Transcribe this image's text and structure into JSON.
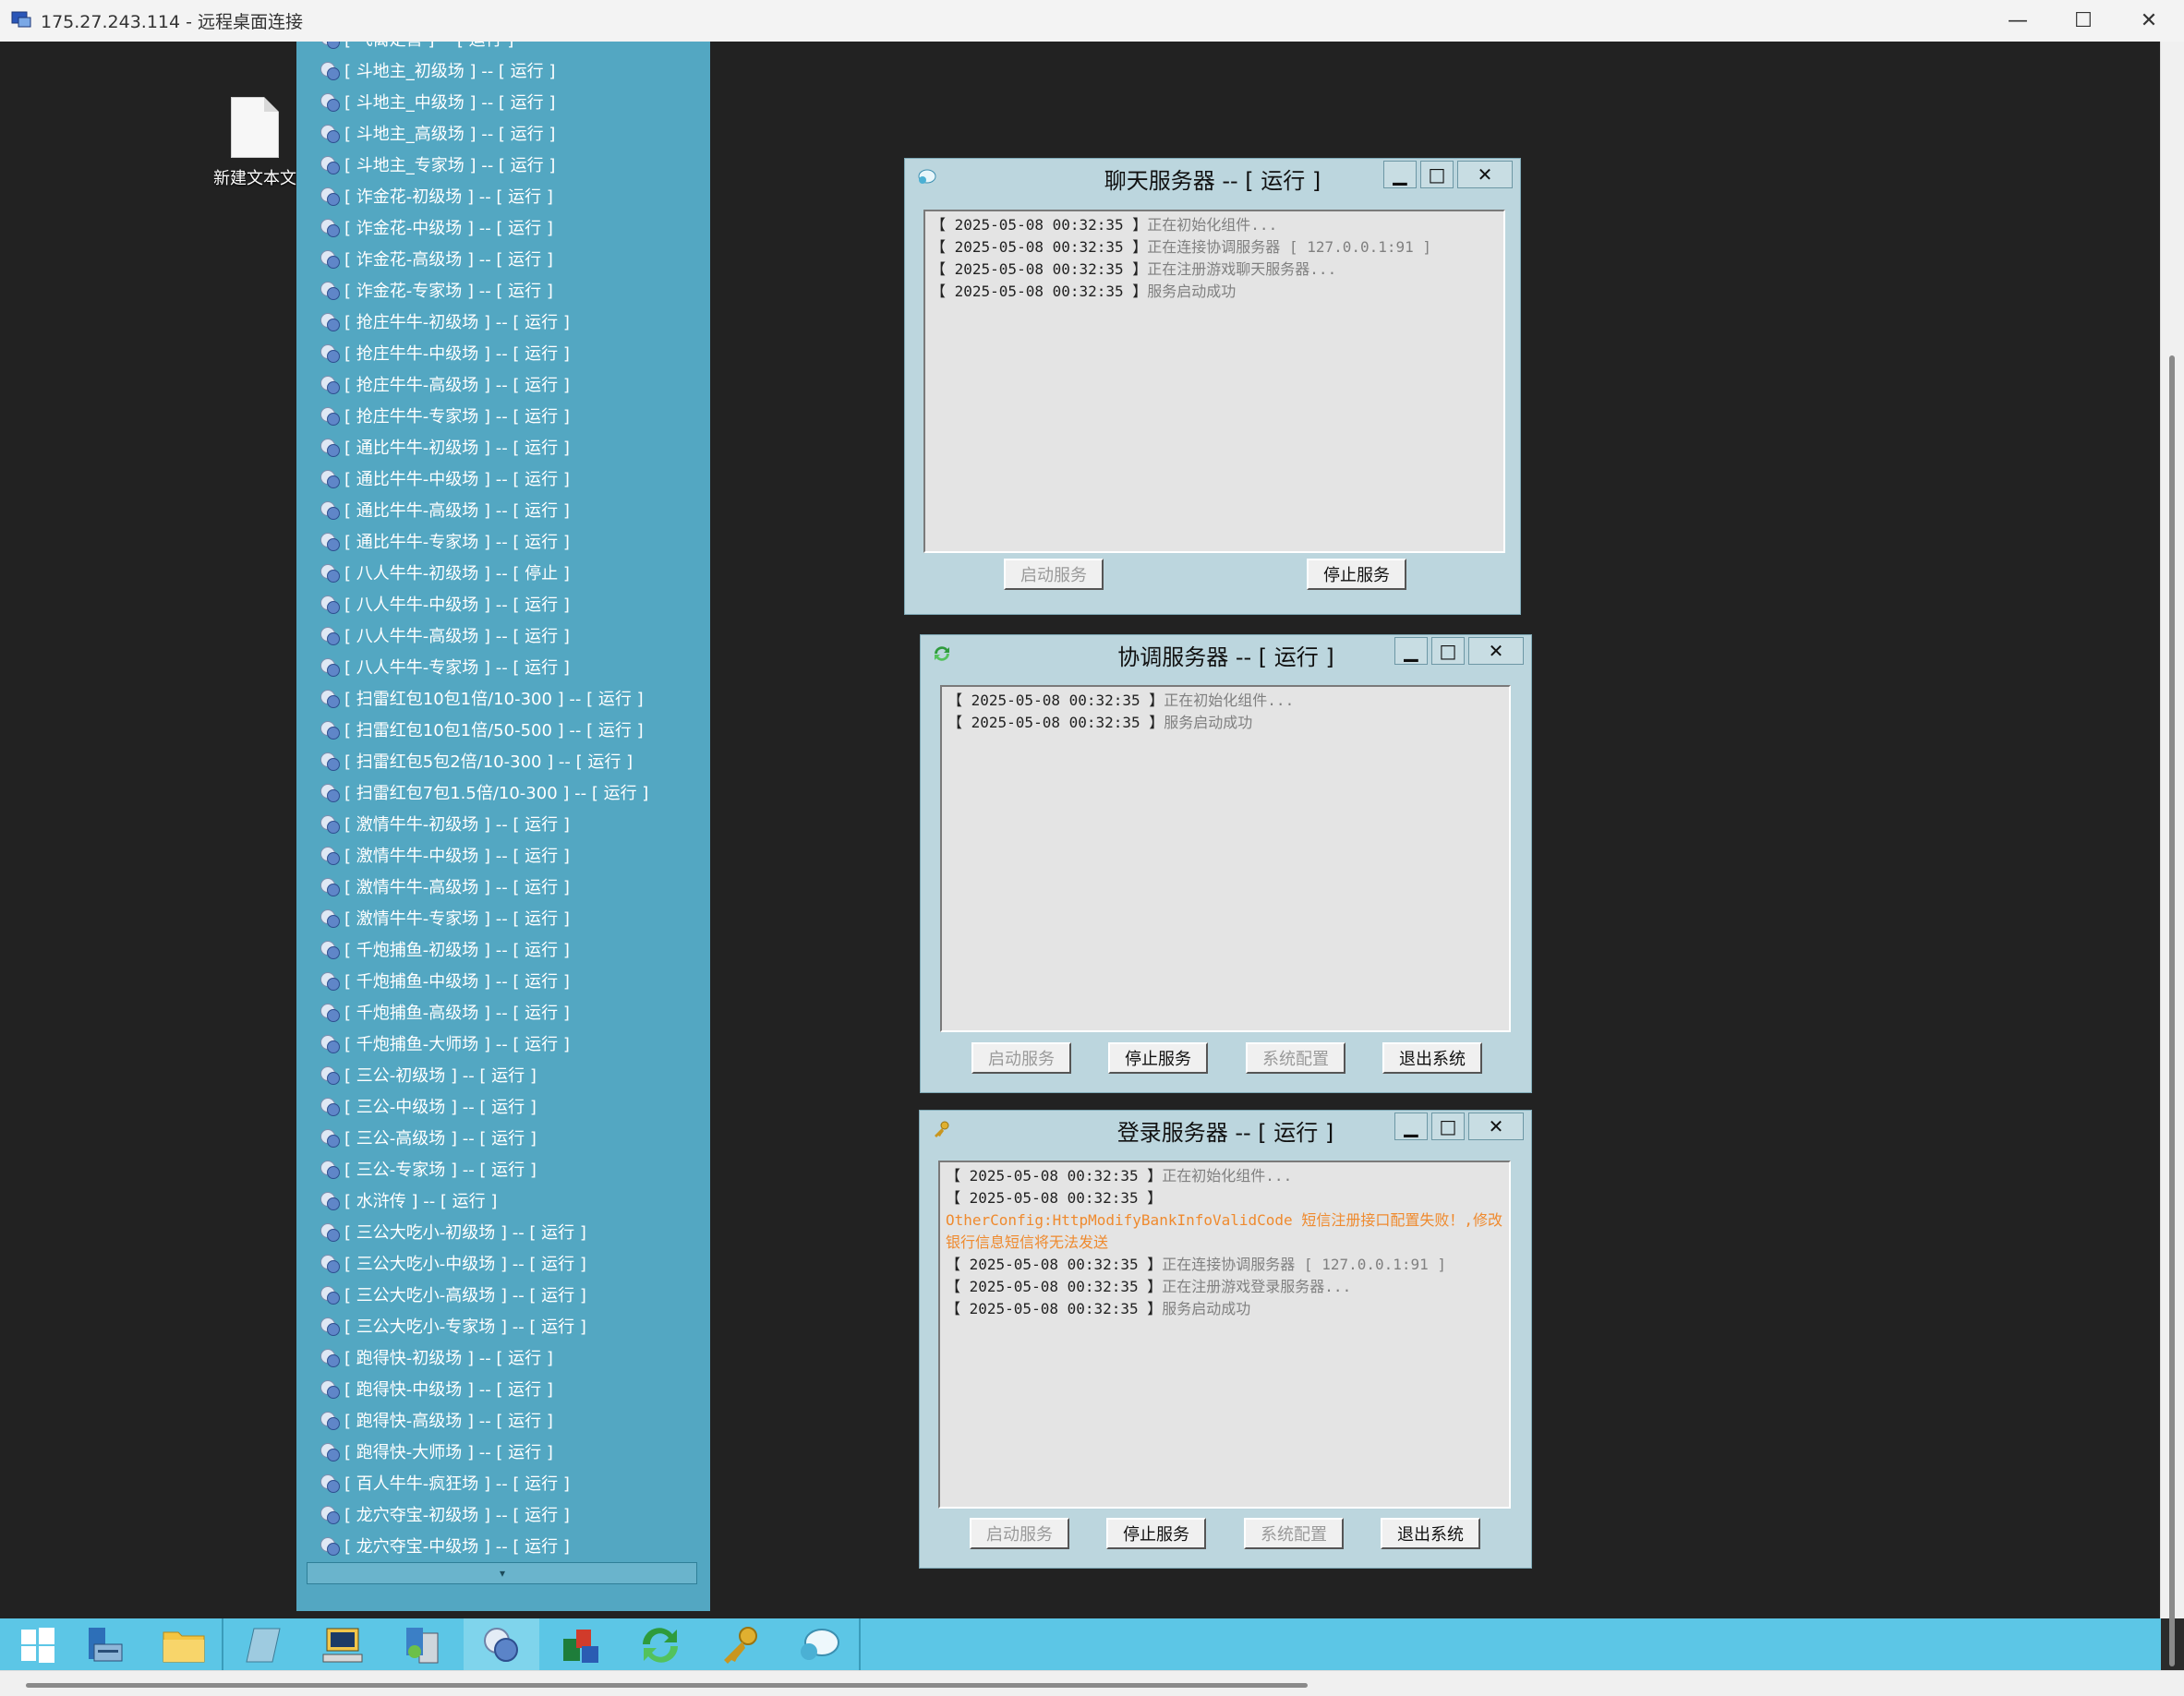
{
  "window": {
    "title": "175.27.243.114 - 远程桌面连接",
    "minimize": "—",
    "maximize": "☐",
    "close": "✕"
  },
  "desktop": {
    "file_label": "新建文本文"
  },
  "room_list": {
    "items": [
      "[ 飞禽走兽 ] -- [ 运行 ]",
      "[ 斗地主_初级场 ] -- [ 运行 ]",
      "[ 斗地主_中级场 ] -- [ 运行 ]",
      "[ 斗地主_高级场 ] -- [ 运行 ]",
      "[ 斗地主_专家场 ] -- [ 运行 ]",
      "[ 诈金花-初级场 ] -- [ 运行 ]",
      "[ 诈金花-中级场 ] -- [ 运行 ]",
      "[ 诈金花-高级场 ] -- [ 运行 ]",
      "[ 诈金花-专家场 ] -- [ 运行 ]",
      "[ 抢庄牛牛-初级场 ] -- [ 运行 ]",
      "[ 抢庄牛牛-中级场 ] -- [ 运行 ]",
      "[ 抢庄牛牛-高级场 ] -- [ 运行 ]",
      "[ 抢庄牛牛-专家场 ] -- [ 运行 ]",
      "[ 通比牛牛-初级场 ] -- [ 运行 ]",
      "[ 通比牛牛-中级场 ] -- [ 运行 ]",
      "[ 通比牛牛-高级场 ] -- [ 运行 ]",
      "[ 通比牛牛-专家场 ] -- [ 运行 ]",
      "[ 八人牛牛-初级场 ] -- [ 停止 ]",
      "[ 八人牛牛-中级场 ] -- [ 运行 ]",
      "[ 八人牛牛-高级场 ] -- [ 运行 ]",
      "[ 八人牛牛-专家场 ] -- [ 运行 ]",
      "[ 扫雷红包10包1倍/10-300 ] -- [ 运行 ]",
      "[ 扫雷红包10包1倍/50-500 ] -- [ 运行 ]",
      "[ 扫雷红包5包2倍/10-300 ] -- [ 运行 ]",
      "[ 扫雷红包7包1.5倍/10-300 ] -- [ 运行 ]",
      "[ 激情牛牛-初级场 ] -- [ 运行 ]",
      "[ 激情牛牛-中级场 ] -- [ 运行 ]",
      "[ 激情牛牛-高级场 ] -- [ 运行 ]",
      "[ 激情牛牛-专家场 ] -- [ 运行 ]",
      "[ 千炮捕鱼-初级场 ] -- [ 运行 ]",
      "[ 千炮捕鱼-中级场 ] -- [ 运行 ]",
      "[ 千炮捕鱼-高级场 ] -- [ 运行 ]",
      "[ 千炮捕鱼-大师场 ] -- [ 运行 ]",
      "[ 三公-初级场 ] -- [ 运行 ]",
      "[ 三公-中级场 ] -- [ 运行 ]",
      "[ 三公-高级场 ] -- [ 运行 ]",
      "[ 三公-专家场 ] -- [ 运行 ]",
      "[ 水浒传 ] -- [ 运行 ]",
      "[ 三公大吃小-初级场 ] -- [ 运行 ]",
      "[ 三公大吃小-中级场 ] -- [ 运行 ]",
      "[ 三公大吃小-高级场 ] -- [ 运行 ]",
      "[ 三公大吃小-专家场 ] -- [ 运行 ]",
      "[ 跑得快-初级场 ] -- [ 运行 ]",
      "[ 跑得快-中级场 ] -- [ 运行 ]",
      "[ 跑得快-高级场 ] -- [ 运行 ]",
      "[ 跑得快-大师场 ] -- [ 运行 ]",
      "[ 百人牛牛-疯狂场 ] -- [ 运行 ]",
      "[ 龙穴夺宝-初级场 ] -- [ 运行 ]",
      "[ 龙穴夺宝-中级场 ] -- [ 运行 ]"
    ],
    "footer_arrow": "▾"
  },
  "chat_server": {
    "title": "聊天服务器 -- [ 运行 ]",
    "logs": [
      {
        "time": "【 2025-05-08 00:32:35 】",
        "msg": "正在初始化组件..."
      },
      {
        "time": "【 2025-05-08 00:32:35 】",
        "msg": "正在连接协调服务器 [ 127.0.0.1:91 ]"
      },
      {
        "time": "【 2025-05-08 00:32:35 】",
        "msg": "正在注册游戏聊天服务器..."
      },
      {
        "time": "【 2025-05-08 00:32:35 】",
        "msg": "服务启动成功"
      }
    ],
    "start_label": "启动服务",
    "stop_label": "停止服务"
  },
  "coord_server": {
    "title": "协调服务器 -- [ 运行 ]",
    "logs": [
      {
        "time": "【 2025-05-08 00:32:35 】",
        "msg": "正在初始化组件..."
      },
      {
        "time": "【 2025-05-08 00:32:35 】",
        "msg": "服务启动成功"
      }
    ],
    "start_label": "启动服务",
    "stop_label": "停止服务",
    "config_label": "系统配置",
    "exit_label": "退出系统"
  },
  "login_server": {
    "title": "登录服务器 -- [ 运行 ]",
    "logs": [
      {
        "time": "【 2025-05-08 00:32:35 】",
        "msg": "正在初始化组件..."
      },
      {
        "time": "【 2025-05-08 00:32:35 】",
        "msg": "OtherConfig:HttpModifyBankInfoValidCode 短信注册接口配置失败！,修改银行信息短信将无法发送",
        "warn": true
      },
      {
        "time": "【 2025-05-08 00:32:35 】",
        "msg": "正在连接协调服务器 [ 127.0.0.1:91 ]"
      },
      {
        "time": "【 2025-05-08 00:32:35 】",
        "msg": "正在注册游戏登录服务器..."
      },
      {
        "time": "【 2025-05-08 00:32:35 】",
        "msg": "服务启动成功"
      }
    ],
    "start_label": "启动服务",
    "stop_label": "停止服务",
    "config_label": "系统配置",
    "exit_label": "退出系统"
  },
  "dialog_controls": {
    "minimize": "▁",
    "maximize": "□",
    "close": "✕"
  },
  "taskbar": {
    "icons": [
      "windows-start-icon",
      "server-manager-icon",
      "file-explorer-icon",
      "notepad-icon",
      "computer-icon",
      "database-tool-icon",
      "game-server-icon",
      "office-icon",
      "coordination-server-icon",
      "login-server-icon",
      "chat-server-icon"
    ]
  },
  "colors": {
    "room_panel": "#53a7c2",
    "dialog_bg": "#bcd6de",
    "taskbar": "#5cc6e6",
    "warn_text": "#ef8a2e"
  }
}
